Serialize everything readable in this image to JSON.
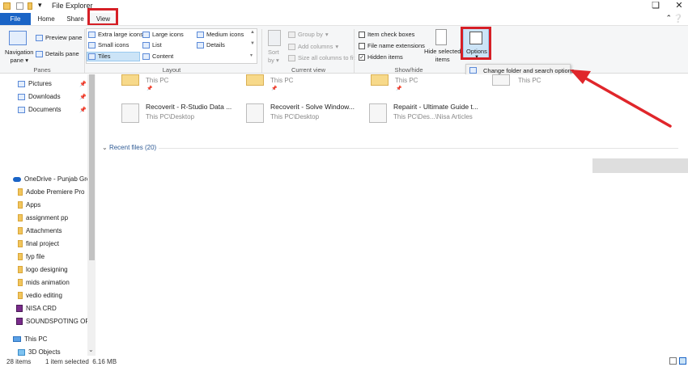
{
  "window": {
    "title": "File Explorer"
  },
  "tabs": {
    "file": "File",
    "home": "Home",
    "share": "Share",
    "view": "View"
  },
  "ribbon": {
    "panes": {
      "label": "Panes",
      "navigation_pane": "Navigation pane",
      "navigation_pane_line1": "Navigation",
      "navigation_pane_line2": "pane",
      "preview_pane": "Preview pane",
      "details_pane": "Details pane"
    },
    "layout": {
      "label": "Layout",
      "extra_large_icons": "Extra large icons",
      "large_icons": "Large icons",
      "medium_icons": "Medium icons",
      "small_icons": "Small icons",
      "list": "List",
      "details": "Details",
      "tiles": "Tiles",
      "content": "Content"
    },
    "current_view": {
      "label": "Current view",
      "sort_by_line1": "Sort",
      "sort_by_line2": "by",
      "group_by": "Group by",
      "add_columns": "Add columns",
      "size_all_columns": "Size all columns to fit"
    },
    "show_hide": {
      "label": "Show/hide",
      "item_check_boxes": "Item check boxes",
      "file_name_extensions": "File name extensions",
      "hidden_items": "Hidden items",
      "hide_selected_line1": "Hide selected",
      "hide_selected_line2": "items"
    },
    "options": {
      "label": "Options",
      "dropdown_item": "Change folder and search options"
    }
  },
  "nav": {
    "quick": [
      {
        "label": "Pictures",
        "icon": "pictures-icon"
      },
      {
        "label": "Downloads",
        "icon": "downloads-icon"
      },
      {
        "label": "Documents",
        "icon": "documents-icon"
      }
    ],
    "onedrive": "OneDrive - Punjab Gro",
    "folders": [
      "Adobe Premiere Pro",
      "Apps",
      "assignment pp",
      "Attachments",
      "final project",
      "fyp file",
      "logo designing",
      "mids animation",
      "vedio editing",
      "NISA CRD",
      "SOUNDSPOTING OF"
    ],
    "this_pc": "This PC",
    "objects_3d": "3D Objects"
  },
  "content": {
    "top_row": [
      {
        "sub": "This PC"
      },
      {
        "sub": "This PC"
      },
      {
        "sub": "This PC"
      },
      {
        "sub": "This PC"
      }
    ],
    "tiles": [
      {
        "title": "Recoverit - R-Studio Data ...",
        "sub": "This PC\\Desktop"
      },
      {
        "title": "Recoverit - Solve Window...",
        "sub": "This PC\\Desktop"
      },
      {
        "title": "Repairit - Ultimate Guide t...",
        "sub": "This PC\\Des...\\Nisa Articles"
      }
    ],
    "recent_files": "Recent files (20)"
  },
  "status": {
    "items": "28 items",
    "selected": "1 item selected  6.16 MB"
  },
  "colors": {
    "accent": "#1a64c6",
    "highlight": "#d61f26",
    "selection": "#cce4f7"
  }
}
